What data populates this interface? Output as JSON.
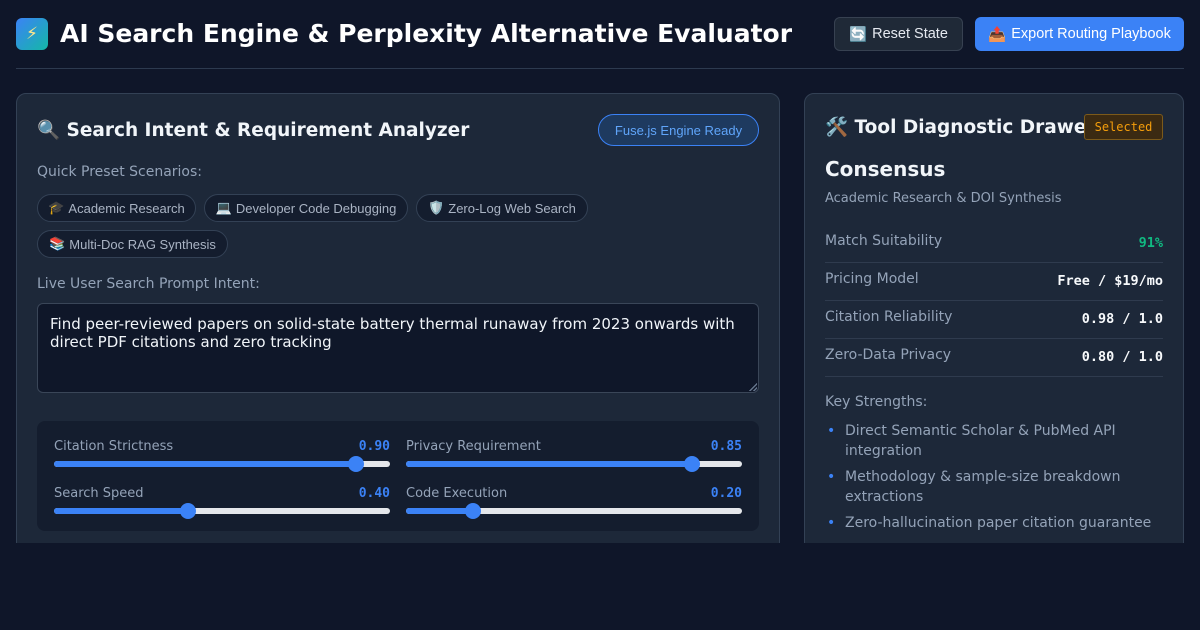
{
  "header": {
    "logo_icon": "⚡",
    "title": "AI Search Engine & Perplexity Alternative Evaluator",
    "reset_icon": "🔄",
    "reset_label": "Reset State",
    "export_icon": "📤",
    "export_label": "Export Routing Playbook"
  },
  "analyzer": {
    "title_icon": "🔍",
    "title": "Search Intent & Requirement Analyzer",
    "engine_status": "Fuse.js Engine Ready",
    "presets_label": "Quick Preset Scenarios:",
    "presets": [
      {
        "icon": "🎓",
        "label": "Academic Research"
      },
      {
        "icon": "💻",
        "label": "Developer Code Debugging"
      },
      {
        "icon": "🛡️",
        "label": "Zero-Log Web Search"
      },
      {
        "icon": "📚",
        "label": "Multi-Doc RAG Synthesis"
      }
    ],
    "prompt_label": "Live User Search Prompt Intent:",
    "prompt_value": "Find peer-reviewed papers on solid-state battery thermal runaway from 2023 onwards with direct PDF citations and zero tracking",
    "sliders": [
      {
        "name": "Citation Strictness",
        "value": 0.9,
        "display": "0.90"
      },
      {
        "name": "Privacy Requirement",
        "value": 0.85,
        "display": "0.85"
      },
      {
        "name": "Search Speed",
        "value": 0.4,
        "display": "0.40"
      },
      {
        "name": "Code Execution",
        "value": 0.2,
        "display": "0.20"
      }
    ]
  },
  "drawer": {
    "title_icon": "🛠️",
    "title": "Tool Diagnostic Drawer",
    "badge": "Selected",
    "tool_name": "Consensus",
    "tool_subtitle": "Academic Research & DOI Synthesis",
    "stats": [
      {
        "label": "Match Suitability",
        "value": "91%"
      },
      {
        "label": "Pricing Model",
        "value": "Free / $19/mo"
      },
      {
        "label": "Citation Reliability",
        "value": "0.98 / 1.0"
      },
      {
        "label": "Zero-Data Privacy",
        "value": "0.80 / 1.0"
      }
    ],
    "strengths_label": "Key Strengths:",
    "strengths": [
      "Direct Semantic Scholar & PubMed API integration",
      "Methodology & sample-size breakdown extractions",
      "Zero-hallucination paper citation guarantee"
    ]
  },
  "colors": {
    "accent": "#3b82f6",
    "success": "#10b981",
    "warning": "#f59e0b",
    "background": "#0f1629",
    "panel": "#1d2839"
  }
}
